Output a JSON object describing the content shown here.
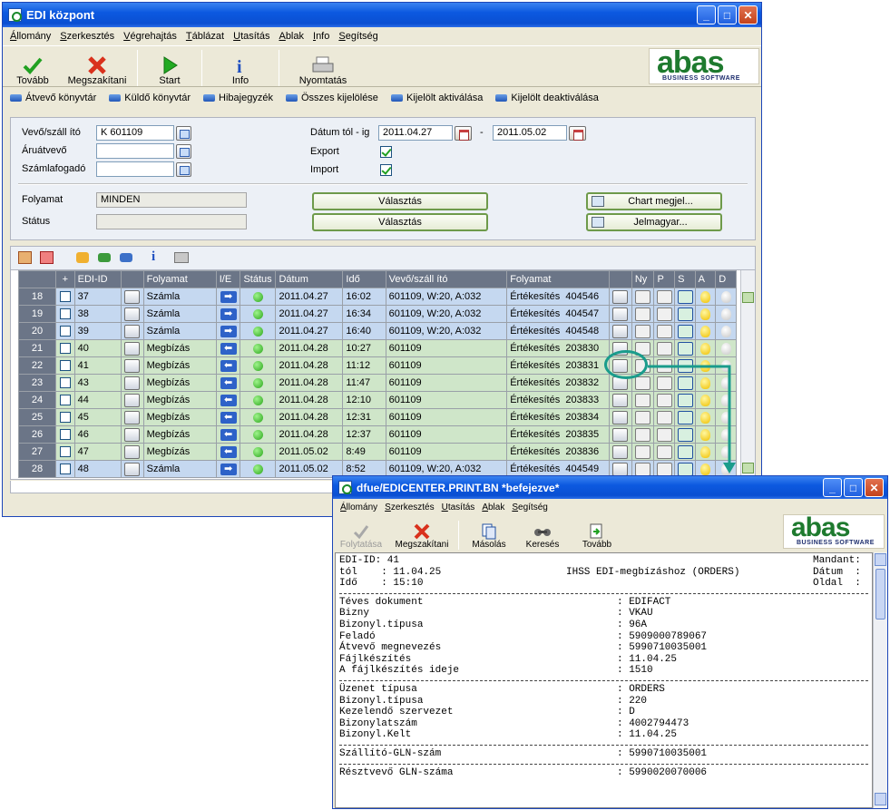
{
  "main": {
    "title": "EDI központ",
    "menu": [
      "Állomány",
      "Szerkesztés",
      "Végrehajtás",
      "Táblázat",
      "Utasítás",
      "Ablak",
      "Info",
      "Segítség"
    ],
    "toolbar": {
      "tovabb": "Tovább",
      "megszakitani": "Megszakítani",
      "start": "Start",
      "info": "Info",
      "nyomtatas": "Nyomtatás"
    },
    "logo": {
      "word": "abas",
      "sub": "BUSINESS SOFTWARE"
    },
    "links": [
      "Átvevő könyvtár",
      "Küldő könyvtár",
      "Hibajegyzék",
      "Összes kijelölése",
      "Kijelölt aktiválása",
      "Kijelölt deaktiválása"
    ],
    "form": {
      "vevo_label": "Vevő/száll ító",
      "vevo_value": "K 601109",
      "aruatvevo_label": "Áruátvevő",
      "szamlafogado_label": "Számlafogadó",
      "datum_label": "Dátum tól - ig",
      "datum_from": "2011.04.27",
      "datum_sep": "-",
      "datum_to": "2011.05.02",
      "export_label": "Export",
      "import_label": "Import",
      "folyamat_label": "Folyamat",
      "folyamat_value": "MINDEN",
      "status_label": "Státus",
      "valasztas1": "Választás",
      "valasztas2": "Választás",
      "chart_btn": "Chart megjel...",
      "jelmagyar_btn": "Jelmagyar..."
    },
    "grid": {
      "headers": [
        "",
        "+",
        "EDI-ID",
        "",
        "Folyamat",
        "I/E",
        "Státus",
        "Dátum",
        "Idő",
        "Vevő/száll ító",
        "Folyamat",
        "",
        "Ny",
        "P",
        "S",
        "A",
        "D"
      ],
      "rows": [
        {
          "n": "18",
          "id": "37",
          "folyamat": "Számla",
          "dir": "out",
          "datum": "2011.04.27",
          "ido": "16:02",
          "vevo": "601109, W:20, A:032",
          "fol2": "Értékesítés",
          "ref": "404546",
          "color": "blue"
        },
        {
          "n": "19",
          "id": "38",
          "folyamat": "Számla",
          "dir": "out",
          "datum": "2011.04.27",
          "ido": "16:34",
          "vevo": "601109, W:20, A:032",
          "fol2": "Értékesítés",
          "ref": "404547",
          "color": "blue"
        },
        {
          "n": "20",
          "id": "39",
          "folyamat": "Számla",
          "dir": "out",
          "datum": "2011.04.27",
          "ido": "16:40",
          "vevo": "601109, W:20, A:032",
          "fol2": "Értékesítés",
          "ref": "404548",
          "color": "blue"
        },
        {
          "n": "21",
          "id": "40",
          "folyamat": "Megbízás",
          "dir": "in",
          "datum": "2011.04.28",
          "ido": "10:27",
          "vevo": "601109",
          "fol2": "Értékesítés",
          "ref": "203830",
          "color": "green"
        },
        {
          "n": "22",
          "id": "41",
          "folyamat": "Megbízás",
          "dir": "in",
          "datum": "2011.04.28",
          "ido": "11:12",
          "vevo": "601109",
          "fol2": "Értékesítés",
          "ref": "203831",
          "color": "green"
        },
        {
          "n": "23",
          "id": "43",
          "folyamat": "Megbízás",
          "dir": "in",
          "datum": "2011.04.28",
          "ido": "11:47",
          "vevo": "601109",
          "fol2": "Értékesítés",
          "ref": "203832",
          "color": "green"
        },
        {
          "n": "24",
          "id": "44",
          "folyamat": "Megbízás",
          "dir": "in",
          "datum": "2011.04.28",
          "ido": "12:10",
          "vevo": "601109",
          "fol2": "Értékesítés",
          "ref": "203833",
          "color": "green"
        },
        {
          "n": "25",
          "id": "45",
          "folyamat": "Megbízás",
          "dir": "in",
          "datum": "2011.04.28",
          "ido": "12:31",
          "vevo": "601109",
          "fol2": "Értékesítés",
          "ref": "203834",
          "color": "green"
        },
        {
          "n": "26",
          "id": "46",
          "folyamat": "Megbízás",
          "dir": "in",
          "datum": "2011.04.28",
          "ido": "12:37",
          "vevo": "601109",
          "fol2": "Értékesítés",
          "ref": "203835",
          "color": "green"
        },
        {
          "n": "27",
          "id": "47",
          "folyamat": "Megbízás",
          "dir": "in",
          "datum": "2011.05.02",
          "ido": "8:49",
          "vevo": "601109",
          "fol2": "Értékesítés",
          "ref": "203836",
          "color": "green"
        },
        {
          "n": "28",
          "id": "48",
          "folyamat": "Számla",
          "dir": "out",
          "datum": "2011.05.02",
          "ido": "8:52",
          "vevo": "601109, W:20, A:032",
          "fol2": "Értékesítés",
          "ref": "404549",
          "color": "blue"
        }
      ]
    }
  },
  "print": {
    "title": "dfue/EDICENTER.PRINT.BN *befejezve*",
    "menu": [
      "Állomány",
      "Szerkesztés",
      "Utasítás",
      "Ablak",
      "Segítség"
    ],
    "toolbar": {
      "folytatasa": "Folytatása",
      "megszakitani": "Megszakítani",
      "masolas": "Másolás",
      "kereses": "Keresés",
      "tovabb": "Tovább"
    },
    "logo": {
      "word": "abas",
      "sub": "BUSINESS SOFTWARE"
    },
    "header_lines": [
      {
        "left": "EDI-ID: 41",
        "mid": "",
        "right": "Mandant:"
      },
      {
        "left": "tól    : 11.04.25",
        "mid": "IHSS EDI-megbízáshoz (ORDERS)",
        "right": "Dátum  :"
      },
      {
        "left": "Idő    : 15:10",
        "mid": "",
        "right": "Oldal  :"
      }
    ],
    "section1": [
      [
        "Téves dokument",
        ": EDIFACT"
      ],
      [
        "Bizny",
        ": VKAU"
      ],
      [
        "Bizonyl.típusa",
        ": 96A"
      ],
      [
        "Feladó",
        ": 5909000789067"
      ],
      [
        "Átvevő megnevezés",
        ": 5990710035001"
      ],
      [
        "Fájlkészítés",
        ": 11.04.25"
      ],
      [
        "A fájlkészítés ideje",
        ": 1510"
      ]
    ],
    "section2": [
      [
        "Üzenet típusa",
        ": ORDERS"
      ],
      [
        "Bizonyl.típusa",
        ": 220"
      ],
      [
        "Kezelendő szervezet",
        ": D"
      ],
      [
        "Bizonylatszám",
        ": 4002794473"
      ],
      [
        "Bizonyl.Kelt",
        ": 11.04.25"
      ]
    ],
    "section3": [
      [
        "Szállító-GLN-szám",
        ": 5990710035001"
      ]
    ],
    "section4": [
      [
        "Résztvevő GLN-száma",
        ": 5990020070006"
      ]
    ]
  },
  "colors": {
    "accent": "#0a4fd2",
    "row_blue": "#c5d8f0",
    "row_green": "#cfe6c9",
    "annotation": "#1a9c8c"
  }
}
